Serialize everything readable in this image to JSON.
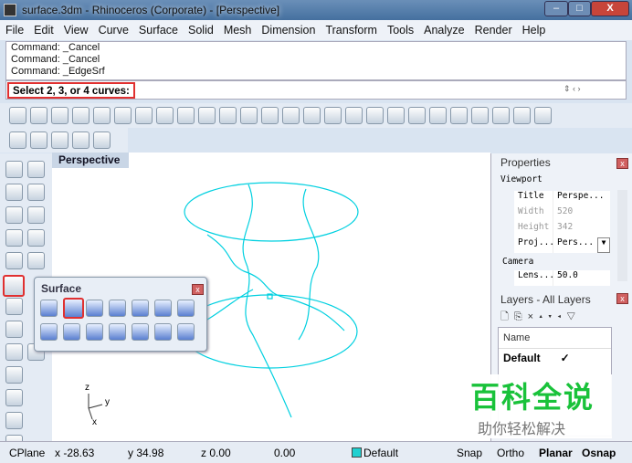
{
  "window": {
    "title": "surface.3dm - Rhinoceros (Corporate) - [Perspective]",
    "min": "–",
    "max": "□",
    "close": "X"
  },
  "menu": [
    "File",
    "Edit",
    "View",
    "Curve",
    "Surface",
    "Solid",
    "Mesh",
    "Dimension",
    "Transform",
    "Tools",
    "Analyze",
    "Render",
    "Help"
  ],
  "history": [
    "Command: _Cancel",
    "Command: _Cancel",
    "Command: _EdgeSrf"
  ],
  "prompt": "Select 2, 3, or 4 curves:",
  "viewport": {
    "tab": "Perspective",
    "axes": {
      "z": "z",
      "y": "y",
      "x": "x"
    },
    "curve_color": "#00d0e0"
  },
  "surface_panel": {
    "title": "Surface",
    "close": "x"
  },
  "properties": {
    "title": "Properties",
    "section_viewport": "Viewport",
    "rows": [
      {
        "k": "Title",
        "v": "Perspe..."
      },
      {
        "k": "Width",
        "v": "520"
      },
      {
        "k": "Height",
        "v": "342"
      },
      {
        "k": "Proj...",
        "v": "Pers..."
      }
    ],
    "section_camera": "Camera",
    "lens": {
      "k": "Lens...",
      "v": "50.0"
    }
  },
  "layers": {
    "title": "Layers - All Layers",
    "col_name": "Name",
    "rows": [
      {
        "name": "Default",
        "check": "✓"
      }
    ]
  },
  "status": {
    "cplane": "CPlane",
    "x": "x -28.63",
    "y": "y 34.98",
    "z": "z 0.00",
    "d": "0.00",
    "layer": "Default",
    "layer_color": "#20d0d0",
    "snap": "Snap",
    "ortho": "Ortho",
    "planar": "Planar",
    "osnap": "Osnap"
  },
  "watermark": {
    "title": "百科全说",
    "sub": "助你轻松解决"
  }
}
